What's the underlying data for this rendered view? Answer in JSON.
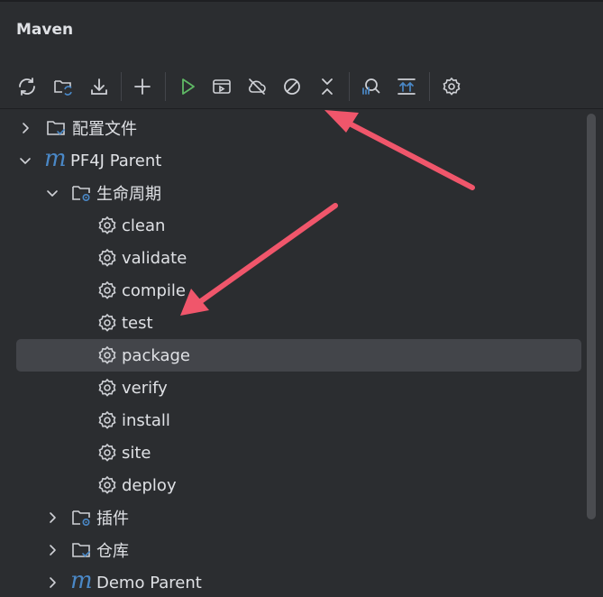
{
  "panel": {
    "title": "Maven"
  },
  "toolbar": {
    "buttons": [
      {
        "icon": "reload-icon"
      },
      {
        "icon": "add-folder-sync-icon"
      },
      {
        "icon": "download-icon"
      },
      {
        "icon": "plus-icon"
      },
      {
        "icon": "run-icon"
      },
      {
        "icon": "run-config-icon"
      },
      {
        "icon": "offline-icon"
      },
      {
        "icon": "skip-tests-icon"
      },
      {
        "icon": "collapse-icon"
      },
      {
        "icon": "analyze-dependencies-icon"
      },
      {
        "icon": "expand-all-icon"
      },
      {
        "icon": "settings-icon"
      }
    ]
  },
  "tree": {
    "profiles": "配置文件",
    "project1": "PF4J Parent",
    "lifecycle": "生命周期",
    "goals": [
      "clean",
      "validate",
      "compile",
      "test",
      "package",
      "verify",
      "install",
      "site",
      "deploy"
    ],
    "selected_goal": "package",
    "plugins": "插件",
    "repositories": "仓库",
    "project2": "Demo Parent"
  },
  "colors": {
    "background": "#2b2d30",
    "selection": "#43454a",
    "text": "#dfe1e5",
    "accent_blue": "#4a88c7",
    "run_green": "#5fb865",
    "annotation_arrow": "#f0566b"
  }
}
